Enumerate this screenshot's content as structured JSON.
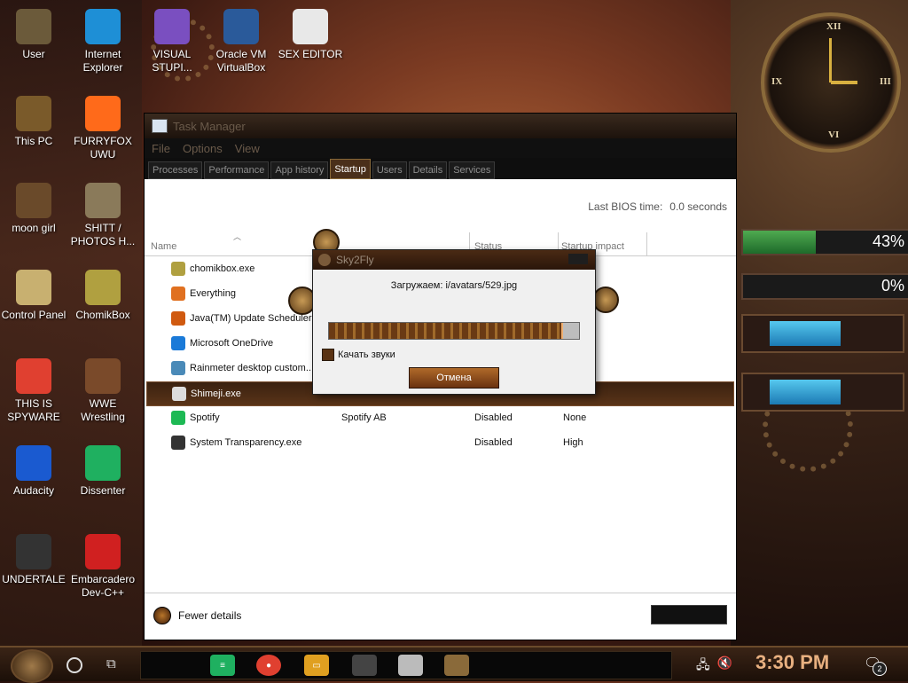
{
  "desktop_icons": [
    {
      "label": "User",
      "icon": "user-icon",
      "color": "#6b5a3a"
    },
    {
      "label": "Internet Explorer",
      "icon": "edge-icon",
      "color": "#1e8fd6"
    },
    {
      "label": "VISUAL STUPI...",
      "icon": "visual-studio-icon",
      "color": "#7a4fc0"
    },
    {
      "label": "Oracle VM VirtualBox",
      "icon": "virtualbox-icon",
      "color": "#2a5a9a"
    },
    {
      "label": "SEX EDITOR",
      "icon": "hxd-icon",
      "color": "#e8e8e8"
    },
    {
      "label": "This PC",
      "icon": "this-pc-icon",
      "color": "#7a5a2a"
    },
    {
      "label": "FURRYFOX UWU",
      "icon": "firefox-icon",
      "color": "#ff6a1a"
    },
    {
      "label": "moon girl",
      "icon": "moon-girl-icon",
      "color": "#6a4a2a"
    },
    {
      "label": "SHITT / PHOTOS H...",
      "icon": "gimp-icon",
      "color": "#8a7a5a"
    },
    {
      "label": "Control Panel",
      "icon": "control-panel-icon",
      "color": "#c8b070"
    },
    {
      "label": "ChomikBox",
      "icon": "chomikbox-icon",
      "color": "#b0a040"
    },
    {
      "label": "THIS IS SPYWARE",
      "icon": "chrome-icon",
      "color": "#e04030"
    },
    {
      "label": "WWE Wrestling",
      "icon": "wwe-icon",
      "color": "#7a4a2a"
    },
    {
      "label": "Audacity",
      "icon": "audacity-icon",
      "color": "#1a5ad0"
    },
    {
      "label": "Dissenter",
      "icon": "dissenter-icon",
      "color": "#1fb060"
    },
    {
      "label": "UNDERTALE",
      "icon": "unity-icon",
      "color": "#333333"
    },
    {
      "label": "Embarcadero Dev-C++",
      "icon": "devcpp-icon",
      "color": "#d02020"
    }
  ],
  "meters": {
    "cpu_percent": "43%",
    "cpu_level": 0.43,
    "ram_percent": "0%",
    "ram_level": 0.0
  },
  "task_manager": {
    "title": "Task Manager",
    "menu": [
      "File",
      "Options",
      "View"
    ],
    "tabs": [
      "Processes",
      "Performance",
      "App history",
      "Startup",
      "Users",
      "Details",
      "Services"
    ],
    "active_tab": "Startup",
    "bios_label": "Last BIOS time:",
    "bios_value": "0.0 seconds",
    "columns": {
      "name": "Name",
      "publisher": "",
      "status": "Status",
      "impact": "Startup impact"
    },
    "rows": [
      {
        "name": "chomikbox.exe",
        "publisher": "",
        "status": "",
        "impact": "",
        "icon": "chomikbox-icon",
        "color": "#b0a040"
      },
      {
        "name": "Everything",
        "publisher": "",
        "status": "",
        "impact": "",
        "icon": "everything-icon",
        "color": "#e07020"
      },
      {
        "name": "Java(TM) Update Scheduler",
        "publisher": "",
        "status": "",
        "impact": "",
        "icon": "java-icon",
        "color": "#d05a10"
      },
      {
        "name": "Microsoft OneDrive",
        "publisher": "",
        "status": "",
        "impact": "",
        "icon": "onedrive-icon",
        "color": "#1a7ad8"
      },
      {
        "name": "Rainmeter desktop custom...",
        "publisher": "",
        "status": "",
        "impact": "",
        "icon": "rainmeter-icon",
        "color": "#4a8ab8"
      },
      {
        "name": "Shimeji.exe",
        "publisher": "",
        "status": "",
        "impact": "",
        "icon": "shimeji-icon",
        "color": "#dddddd",
        "selected": true
      },
      {
        "name": "Spotify",
        "publisher": "Spotify AB",
        "status": "Disabled",
        "impact": "None",
        "icon": "spotify-icon",
        "color": "#1db954"
      },
      {
        "name": "System Transparency.exe",
        "publisher": "",
        "status": "Disabled",
        "impact": "High",
        "icon": "wrench-icon",
        "color": "#333333"
      }
    ],
    "fewer_details": "Fewer details"
  },
  "dialog": {
    "title": "Sky2Fly",
    "message": "Загружаем: i/avatars/529.jpg",
    "progress": 0.93,
    "checkbox_label": "Качать звуки",
    "cancel_label": "Отмена"
  },
  "taskbar": {
    "time": "3:30 PM",
    "notification_count": "2"
  }
}
